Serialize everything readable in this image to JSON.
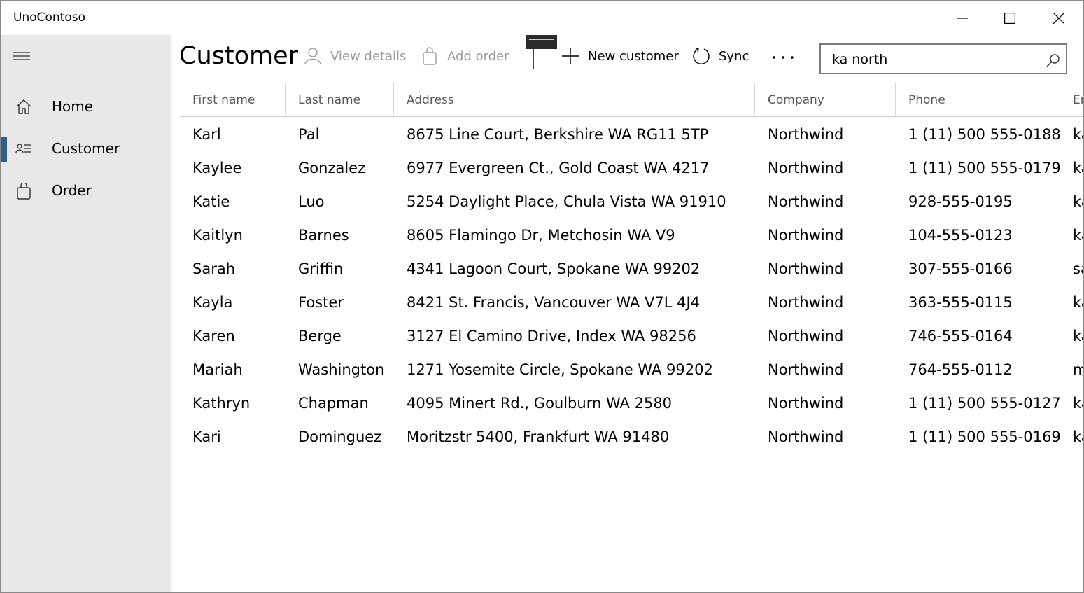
{
  "app": {
    "title": "UnoContoso"
  },
  "window_controls": {
    "minimize": "minimize-icon",
    "maximize": "maximize-icon",
    "close": "close-icon"
  },
  "sidebar": {
    "menu_icon": "hamburger-icon",
    "items": [
      {
        "label": "Home",
        "icon": "home-icon",
        "active": false
      },
      {
        "label": "Customer",
        "icon": "customer-list-icon",
        "active": true
      },
      {
        "label": "Order",
        "icon": "shopping-bag-icon",
        "active": false
      }
    ],
    "accent": "#2f5f91"
  },
  "page": {
    "title": "Customer"
  },
  "commands": {
    "view_details": "View details",
    "add_order": "Add order",
    "new_customer": "New customer",
    "sync": "Sync",
    "more": "more-icon"
  },
  "search": {
    "value": "ka north",
    "icon": "search-icon"
  },
  "table": {
    "columns": [
      "First name",
      "Last name",
      "Address",
      "Company",
      "Phone",
      "Em"
    ],
    "rows": [
      [
        "Karl",
        "Pal",
        "8675 Line Court, Berkshire WA RG11 5TP",
        "Northwind",
        "1 (11) 500 555-0188",
        "ka"
      ],
      [
        "Kaylee",
        "Gonzalez",
        "6977 Evergreen Ct., Gold Coast WA 4217",
        "Northwind",
        "1 (11) 500 555-0179",
        "ka"
      ],
      [
        "Katie",
        "Luo",
        "5254 Daylight Place, Chula Vista WA 91910",
        "Northwind",
        "928-555-0195",
        "ka"
      ],
      [
        "Kaitlyn",
        "Barnes",
        "8605 Flamingo Dr, Metchosin WA V9",
        "Northwind",
        "104-555-0123",
        "ka"
      ],
      [
        "Sarah",
        "Griffin",
        "4341 Lagoon Court, Spokane WA 99202",
        "Northwind",
        "307-555-0166",
        "sa"
      ],
      [
        "Kayla",
        "Foster",
        "8421 St. Francis, Vancouver WA V7L 4J4",
        "Northwind",
        "363-555-0115",
        "ka"
      ],
      [
        "Karen",
        "Berge",
        "3127 El Camino Drive, Index WA 98256",
        "Northwind",
        "746-555-0164",
        "ka"
      ],
      [
        "Mariah",
        "Washington",
        "1271 Yosemite Circle, Spokane WA 99202",
        "Northwind",
        "764-555-0112",
        "m"
      ],
      [
        "Kathryn",
        "Chapman",
        "4095 Minert Rd., Goulburn WA 2580",
        "Northwind",
        "1 (11) 500 555-0127",
        "ka"
      ],
      [
        "Kari",
        "Dominguez",
        "Moritzstr 5400, Frankfurt WA 91480",
        "Northwind",
        "1 (11) 500 555-0169",
        "ka"
      ]
    ]
  }
}
